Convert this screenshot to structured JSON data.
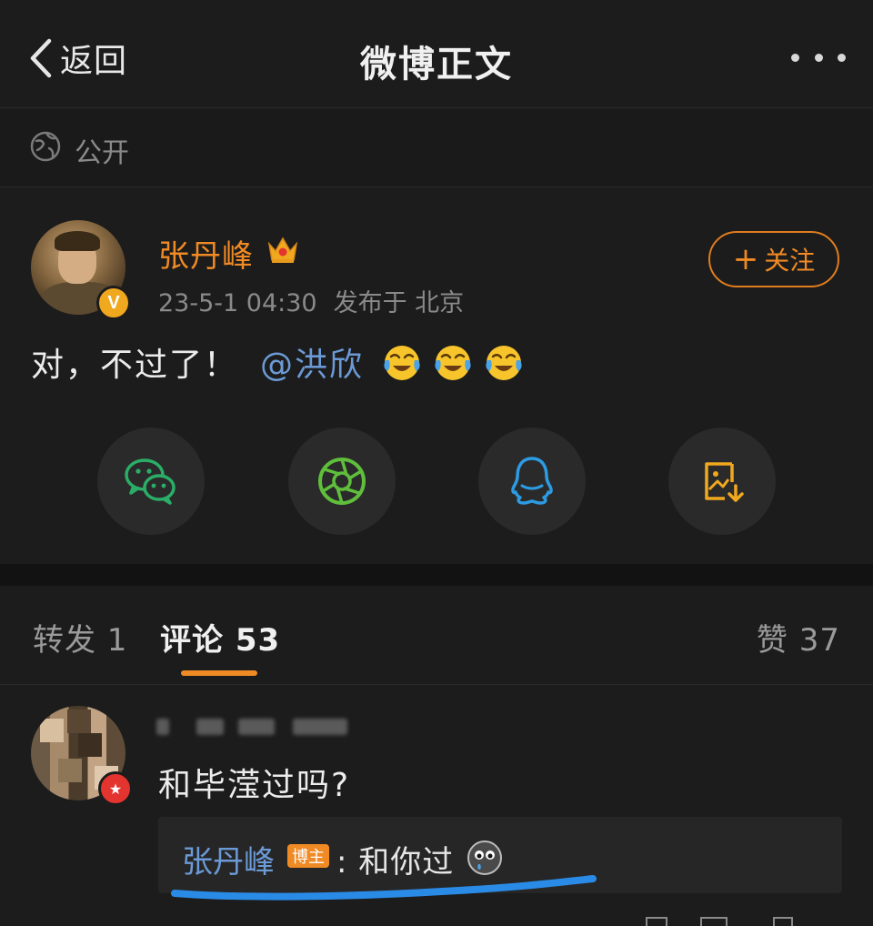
{
  "nav": {
    "back_label": "返回",
    "title": "微博正文"
  },
  "visibility": {
    "label": "公开",
    "icon": "globe-icon"
  },
  "post": {
    "author": "张丹峰",
    "verified_badge": "V",
    "date": "23-5-1 04:30",
    "location": "发布于 北京",
    "follow_label": "关注",
    "text": "对，不过了！",
    "mention": "@洪欣",
    "emojis": [
      "crying-laughing-emoji",
      "crying-laughing-emoji",
      "crying-laughing-emoji"
    ]
  },
  "share": {
    "buttons": [
      "wechat-icon",
      "moments-icon",
      "qq-icon",
      "save-image-icon"
    ],
    "colors": {
      "wechat": "#2aae67",
      "moments": "#5fbf3c",
      "qq": "#2d9be2",
      "save": "#f0a81e"
    }
  },
  "tabs": {
    "repost": "转发 1",
    "comments": "评论 53",
    "likes": "赞 37"
  },
  "comment": {
    "text": "和毕滢过吗?",
    "reply": {
      "author": "张丹峰",
      "badge": "博主",
      "text": ": 和你过"
    }
  },
  "colors": {
    "background": "#1c1c1c",
    "accent": "#f08a24",
    "link": "#6b9ad6"
  }
}
